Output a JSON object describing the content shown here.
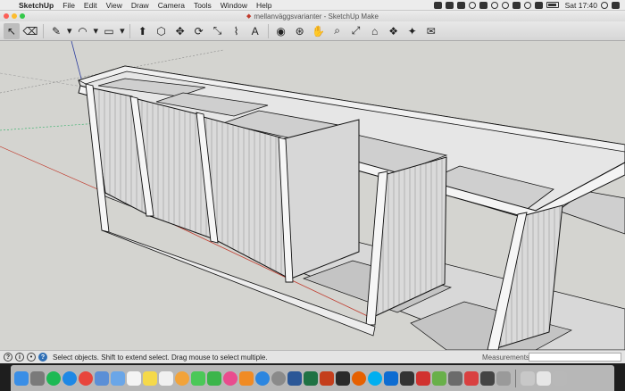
{
  "menubar": {
    "apple_glyph": "",
    "items": [
      "SketchUp",
      "File",
      "Edit",
      "View",
      "Draw",
      "Camera",
      "Tools",
      "Window",
      "Help"
    ],
    "clock": "Sat 17:40"
  },
  "window": {
    "title": "mellanväggsvarianter - SketchUp Make",
    "doc_icon": "sketchup-doc-icon"
  },
  "toolbar": {
    "tools": [
      {
        "name": "select-tool-icon",
        "glyph": "↖",
        "active": true
      },
      {
        "name": "eraser-tool-icon",
        "glyph": "⌫"
      },
      {
        "name": "pencil-line-tool-icon",
        "glyph": "✎",
        "dropdown": true
      },
      {
        "name": "arc-tool-icon",
        "glyph": "◠",
        "dropdown": true
      },
      {
        "name": "rectangle-tool-icon",
        "glyph": "▭",
        "dropdown": true
      },
      {
        "name": "push-pull-tool-icon",
        "glyph": "⬆"
      },
      {
        "name": "offset-tool-icon",
        "glyph": "⬡"
      },
      {
        "name": "move-tool-icon",
        "glyph": "✥"
      },
      {
        "name": "rotate-tool-icon",
        "glyph": "⟳"
      },
      {
        "name": "scale-tool-icon",
        "glyph": "⤡"
      },
      {
        "name": "tape-measure-tool-icon",
        "glyph": "⌇"
      },
      {
        "name": "text-tool-icon",
        "glyph": "A"
      },
      {
        "name": "paint-bucket-tool-icon",
        "glyph": "◉"
      },
      {
        "name": "orbit-tool-icon",
        "glyph": "⊛"
      },
      {
        "name": "pan-tool-icon",
        "glyph": "✋"
      },
      {
        "name": "zoom-tool-icon",
        "glyph": "⌕"
      },
      {
        "name": "zoom-extents-tool-icon",
        "glyph": "⤢"
      },
      {
        "name": "warehouse-tool-icon",
        "glyph": "⌂"
      },
      {
        "name": "components-tool-icon",
        "glyph": "❖"
      },
      {
        "name": "extension-warehouse-tool-icon",
        "glyph": "✦"
      },
      {
        "name": "send-to-layout-tool-icon",
        "glyph": "✉"
      }
    ]
  },
  "statusbar": {
    "message": "Select objects. Shift to extend select. Drag mouse to select multiple.",
    "measurements_label": "Measurements",
    "measurements_value": ""
  },
  "dock": {
    "icons": [
      {
        "name": "finder-icon",
        "color": "#3a8ee6"
      },
      {
        "name": "launchpad-icon",
        "color": "#7a7a7a"
      },
      {
        "name": "spotify-icon",
        "color": "#1db954",
        "round": true
      },
      {
        "name": "safari-icon",
        "color": "#1e88e5",
        "round": true
      },
      {
        "name": "chrome-icon",
        "color": "#e8453c",
        "round": true
      },
      {
        "name": "preview-icon",
        "color": "#5b8fd6"
      },
      {
        "name": "mail-icon",
        "color": "#6aa6e8"
      },
      {
        "name": "calendar-icon",
        "color": "#f4f4f4"
      },
      {
        "name": "notes-icon",
        "color": "#f5d94a"
      },
      {
        "name": "reminders-icon",
        "color": "#f0f0f0"
      },
      {
        "name": "photos-icon",
        "color": "#f2a33a",
        "round": true
      },
      {
        "name": "messages-icon",
        "color": "#4bc858"
      },
      {
        "name": "facetime-icon",
        "color": "#3bb54a"
      },
      {
        "name": "itunes-icon",
        "color": "#e94c8e",
        "round": true
      },
      {
        "name": "ibooks-icon",
        "color": "#f08b24"
      },
      {
        "name": "app-store-icon",
        "color": "#2c86e0",
        "round": true
      },
      {
        "name": "system-preferences-icon",
        "color": "#8a8a8a",
        "round": true
      },
      {
        "name": "word-icon",
        "color": "#2b5797"
      },
      {
        "name": "excel-icon",
        "color": "#1f7244"
      },
      {
        "name": "powerpoint-icon",
        "color": "#c43e1c"
      },
      {
        "name": "terminal-icon",
        "color": "#2a2a2a"
      },
      {
        "name": "firefox-icon",
        "color": "#e66000",
        "round": true
      },
      {
        "name": "skype-icon",
        "color": "#00aff0",
        "round": true
      },
      {
        "name": "dropbox-icon",
        "color": "#0d6cd1"
      },
      {
        "name": "monitor-icon",
        "color": "#333333"
      },
      {
        "name": "sketchup-icon",
        "color": "#d1322f"
      },
      {
        "name": "maps-icon",
        "color": "#69b04a"
      },
      {
        "name": "gimp-icon",
        "color": "#6b6b6b"
      },
      {
        "name": "app-red-icon",
        "color": "#d94040"
      },
      {
        "name": "app-dark-icon",
        "color": "#444444"
      },
      {
        "name": "app-gray-icon",
        "color": "#9a9a9a"
      },
      {
        "name": "downloads-stack-icon",
        "color": "#c8c8c8"
      },
      {
        "name": "documents-stack-icon",
        "color": "#e6e6e6"
      },
      {
        "name": "trash-icon",
        "color": "#b8b8b8"
      }
    ]
  },
  "colors": {
    "sky": "#d4d4d0",
    "face_light": "#e6e6e6",
    "face_mid": "#d2d2d2",
    "face_dark": "#b9b9b9",
    "edge": "#111111",
    "axis_red": "#c0392b",
    "axis_green": "#27ae60",
    "axis_blue": "#2c3e9e"
  }
}
